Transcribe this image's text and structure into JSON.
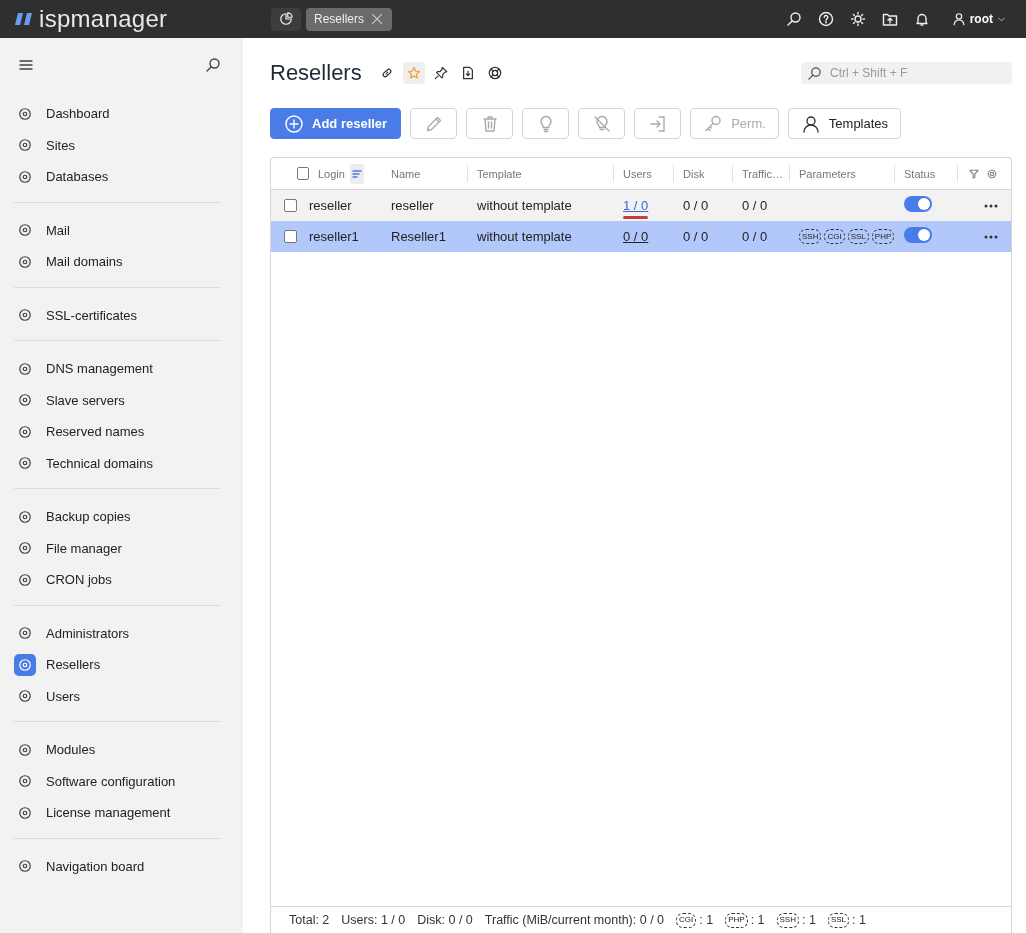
{
  "topbar": {
    "logo": "ispmanager",
    "tabs": [
      {
        "kind": "home",
        "selected": false
      },
      {
        "kind": "page",
        "label": "Resellers",
        "selected": true
      }
    ],
    "user": "root"
  },
  "sidebar": {
    "groups": [
      {
        "items": [
          {
            "label": "Dashboard",
            "selected": false
          },
          {
            "label": "Sites",
            "selected": false
          },
          {
            "label": "Databases",
            "selected": false
          }
        ]
      },
      {
        "items": [
          {
            "label": "Mail",
            "selected": false
          },
          {
            "label": "Mail domains",
            "selected": false
          }
        ]
      },
      {
        "items": [
          {
            "label": "SSL-certificates",
            "selected": false
          }
        ]
      },
      {
        "items": [
          {
            "label": "DNS management",
            "selected": false
          },
          {
            "label": "Slave servers",
            "selected": false
          },
          {
            "label": "Reserved names",
            "selected": false
          },
          {
            "label": "Technical domains",
            "selected": false
          }
        ]
      },
      {
        "items": [
          {
            "label": "Backup copies",
            "selected": false
          },
          {
            "label": "File manager",
            "selected": false
          },
          {
            "label": "CRON jobs",
            "selected": false
          }
        ]
      },
      {
        "items": [
          {
            "label": "Administrators",
            "selected": false
          },
          {
            "label": "Resellers",
            "selected": true
          },
          {
            "label": "Users",
            "selected": false
          }
        ]
      },
      {
        "items": [
          {
            "label": "Modules",
            "selected": false
          },
          {
            "label": "Software configuration",
            "selected": false
          },
          {
            "label": "License management",
            "selected": false
          }
        ]
      },
      {
        "items": [
          {
            "label": "Navigation board",
            "selected": false
          }
        ]
      }
    ]
  },
  "page": {
    "title": "Resellers",
    "favorite": true,
    "search": {
      "placeholder": "Ctrl + Shift + F"
    }
  },
  "toolbar": [
    {
      "kind": "add",
      "label": "Add reseller",
      "disabled": false
    },
    {
      "kind": "edit",
      "disabled": true
    },
    {
      "kind": "delete",
      "disabled": true
    },
    {
      "kind": "bulb",
      "disabled": true
    },
    {
      "kind": "bulb-off",
      "disabled": true
    },
    {
      "kind": "login",
      "disabled": true
    },
    {
      "kind": "key",
      "label": "Perm.",
      "disabled": true
    },
    {
      "kind": "person",
      "label": "Templates",
      "disabled": false
    }
  ],
  "table": {
    "select_all_checked": false,
    "columns": [
      "Login",
      "Name",
      "Template",
      "Users",
      "Disk",
      "Traffic…",
      "Parameters",
      "Status"
    ],
    "rows": [
      {
        "selected": false,
        "hovered": true,
        "checked": false,
        "login": "reseller",
        "name": "reseller",
        "template": "without template",
        "users": "1 / 0",
        "users_flag": true,
        "disk": "0 / 0",
        "traffic": "0 / 0",
        "params": [],
        "on": true
      },
      {
        "selected": true,
        "hovered": false,
        "checked": false,
        "login": "reseller1",
        "name": "Reseller1",
        "template": "without template",
        "users": "0 / 0",
        "users_flag": false,
        "disk": "0 / 0",
        "traffic": "0 / 0",
        "params": [
          "SSH",
          "CGI",
          "SSL",
          "PHP"
        ],
        "on": true
      }
    ],
    "footer": {
      "totals": [
        "Total: 2",
        "Users: 1 / 0",
        "Disk: 0 / 0",
        "Traffic (MiB/current month): 0 / 0"
      ],
      "counts": [
        {
          "badge": "CGI",
          "count": ": 1"
        },
        {
          "badge": "PHP",
          "count": ": 1"
        },
        {
          "badge": "SSH",
          "count": ": 1"
        },
        {
          "badge": "SSL",
          "count": ": 1"
        }
      ]
    }
  }
}
